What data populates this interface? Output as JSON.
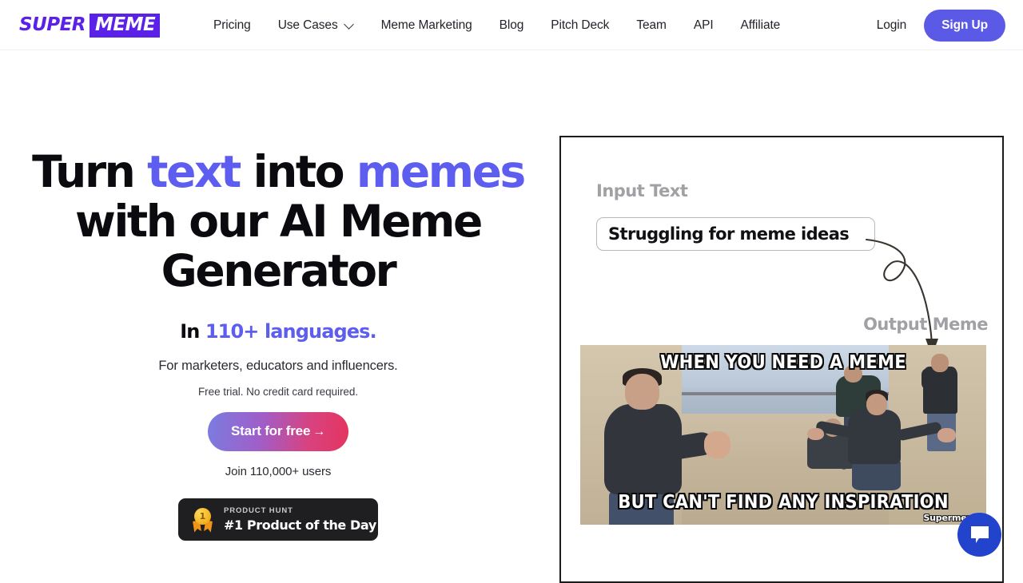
{
  "header": {
    "logo": {
      "part1": "SUPER",
      "part2": "MEME"
    },
    "nav": [
      {
        "label": "Pricing",
        "has_dropdown": false
      },
      {
        "label": "Use Cases",
        "has_dropdown": true
      },
      {
        "label": "Meme Marketing",
        "has_dropdown": false
      },
      {
        "label": "Blog",
        "has_dropdown": false
      },
      {
        "label": "Pitch Deck",
        "has_dropdown": false
      },
      {
        "label": "Team",
        "has_dropdown": false
      },
      {
        "label": "API",
        "has_dropdown": false
      },
      {
        "label": "Affiliate",
        "has_dropdown": false
      }
    ],
    "login_label": "Login",
    "signup_label": "Sign Up",
    "signup_color": "#5a5ae6"
  },
  "hero": {
    "headline": {
      "line1_a": "Turn ",
      "line1_accent1": "text",
      "line1_b": " into ",
      "line1_accent2": "memes",
      "line2": "with our AI Meme",
      "line3": "Generator"
    },
    "languages_prefix": "In ",
    "languages_accent": "110+ languages.",
    "audience": "For marketers, educators and influencers.",
    "trial_note": "Free trial. No credit card required.",
    "cta_label": "Start for free",
    "cta_arrow": "→",
    "join_users": "Join 110,000+ users",
    "accent_color": "#5d5df0",
    "product_hunt": {
      "kicker": "PRODUCT HUNT",
      "title": "#1 Product of the Day",
      "medal_rank": "1"
    }
  },
  "demo_panel": {
    "input_label": "Input Text",
    "input_value": "Struggling for meme ideas",
    "output_label": "Output Meme",
    "meme": {
      "top_text": "WHEN YOU NEED A MEME",
      "bottom_text": "BUT CAN'T FIND ANY INSPIRATION",
      "watermark": "Supermeme"
    }
  },
  "chat_widget": {
    "icon": "chat-bubble-icon",
    "color": "#2244cc"
  }
}
